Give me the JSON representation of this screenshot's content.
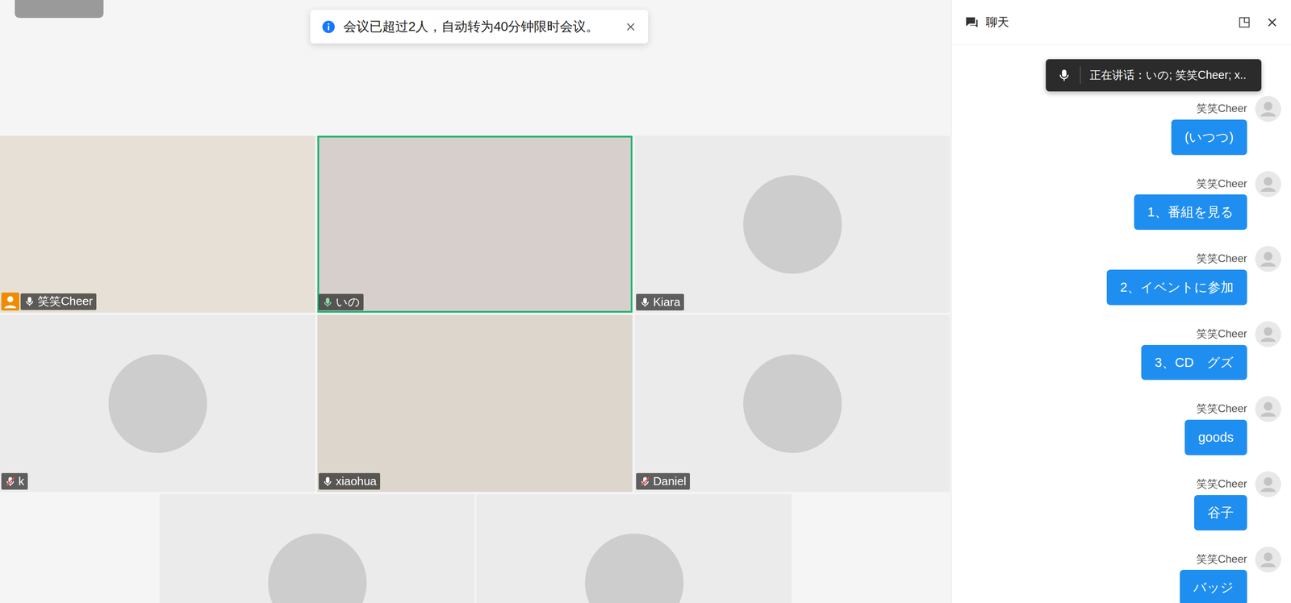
{
  "notice": {
    "text": "会议已超过2人，自动转为40分钟限时会议。"
  },
  "participants": [
    {
      "name": "笑笑Cheer",
      "kind": "video",
      "muted": false,
      "host": true,
      "highlighted": false
    },
    {
      "name": "いの",
      "kind": "video",
      "muted": false,
      "host": false,
      "highlighted": true
    },
    {
      "name": "Kiara",
      "kind": "avatar",
      "muted": false,
      "host": false,
      "highlighted": false
    },
    {
      "name": "k",
      "kind": "avatar",
      "muted": true,
      "host": false,
      "highlighted": false
    },
    {
      "name": "xiaohua",
      "kind": "video",
      "muted": false,
      "host": false,
      "highlighted": false
    },
    {
      "name": "Daniel",
      "kind": "avatar",
      "muted": true,
      "host": false,
      "highlighted": false
    },
    {
      "kind": "avatar",
      "muted": false,
      "host": false,
      "highlighted": false
    },
    {
      "kind": "avatar",
      "muted": false,
      "host": false,
      "highlighted": false
    }
  ],
  "chat": {
    "title": "聊天",
    "speaking_tip": "正在讲话：いの; 笑笑Cheer; x..",
    "messages": [
      {
        "sender": "笑笑Cheer",
        "text": "(いつつ)"
      },
      {
        "sender": "笑笑Cheer",
        "text": "1、番組を見る"
      },
      {
        "sender": "笑笑Cheer",
        "text": "2、イベントに参加"
      },
      {
        "sender": "笑笑Cheer",
        "text": "3、CD　グズ"
      },
      {
        "sender": "笑笑Cheer",
        "text": "goods"
      },
      {
        "sender": "笑笑Cheer",
        "text": "谷子"
      },
      {
        "sender": "笑笑Cheer",
        "text": "バッジ"
      }
    ]
  }
}
